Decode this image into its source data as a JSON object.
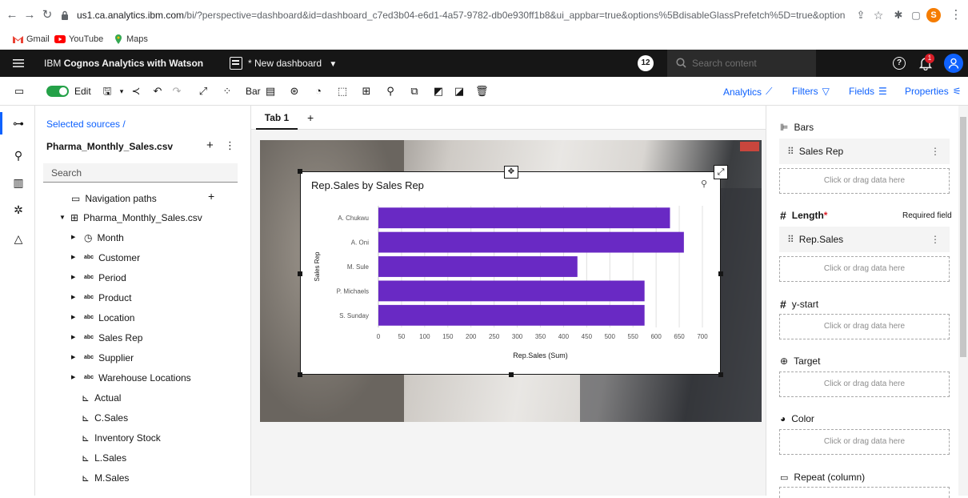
{
  "browser": {
    "url_host": "us1.ca.analytics.ibm.com",
    "url_rest": "/bi/?perspective=dashboard&id=dashboard_c7ed3b04-e6d1-4a57-9782-db0e930ff1b8&ui_appbar=true&options%5BdisableGlassPrefetch%5D=true&options%5Bcol...",
    "bookmarks": [
      "Gmail",
      "YouTube",
      "Maps"
    ],
    "profile_initial": "S"
  },
  "appbar": {
    "brand": "IBM",
    "product": "Cognos Analytics with Watson",
    "dashboard_name": "* New dashboard",
    "notification_count": "12",
    "search_placeholder": "Search content",
    "alert_count": "1"
  },
  "toolbar": {
    "edit_label": "Edit",
    "chart_type": "Bar",
    "analytics_label": "Analytics",
    "filters_label": "Filters",
    "fields_label": "Fields",
    "properties_label": "Properties"
  },
  "data_panel": {
    "breadcrumb": "Selected sources  /",
    "source_name": "Pharma_Monthly_Sales.csv",
    "search_placeholder": "Search",
    "navigation_paths": "Navigation paths",
    "source_node": "Pharma_Monthly_Sales.csv",
    "fields": [
      {
        "label": "Month",
        "kind": "time"
      },
      {
        "label": "Customer",
        "kind": "abc"
      },
      {
        "label": "Period",
        "kind": "abc"
      },
      {
        "label": "Product",
        "kind": "abc"
      },
      {
        "label": "Location",
        "kind": "abc"
      },
      {
        "label": "Sales Rep",
        "kind": "abc"
      },
      {
        "label": "Supplier",
        "kind": "abc"
      },
      {
        "label": "Warehouse Locations",
        "kind": "abc"
      }
    ],
    "measures": [
      "Actual",
      "C.Sales",
      "Inventory Stock",
      "L.Sales",
      "M.Sales"
    ]
  },
  "canvas": {
    "tab_label": "Tab 1",
    "add_tab": "+"
  },
  "chart_data": {
    "type": "bar",
    "orientation": "horizontal",
    "title": "Rep.Sales by Sales Rep",
    "xlabel": "Rep.Sales (Sum)",
    "ylabel": "Sales Rep",
    "categories": [
      "A. Chukwu",
      "A. Oni",
      "M. Sule",
      "P. Michaels",
      "S. Sunday"
    ],
    "values": [
      630,
      660,
      430,
      575,
      575
    ],
    "xlim": [
      0,
      700
    ],
    "xticks": [
      0,
      50,
      100,
      150,
      200,
      250,
      300,
      350,
      400,
      450,
      500,
      550,
      600,
      650,
      700
    ],
    "bar_color": "#6929c4",
    "grid": true
  },
  "properties": {
    "bars_label": "Bars",
    "bars_field": "Sales Rep",
    "drop_text": "Click or drag data here",
    "length_label": "Length",
    "required_mark": "*",
    "required_text": "Required field",
    "length_field": "Rep.Sales",
    "ystart_label": "y-start",
    "target_label": "Target",
    "color_label": "Color",
    "repeat_label": "Repeat (column)"
  },
  "colors": {
    "header_bg": "#161616",
    "link_blue": "#0f62fe",
    "bar": "#6929c4",
    "toggle_green": "#24a148"
  }
}
